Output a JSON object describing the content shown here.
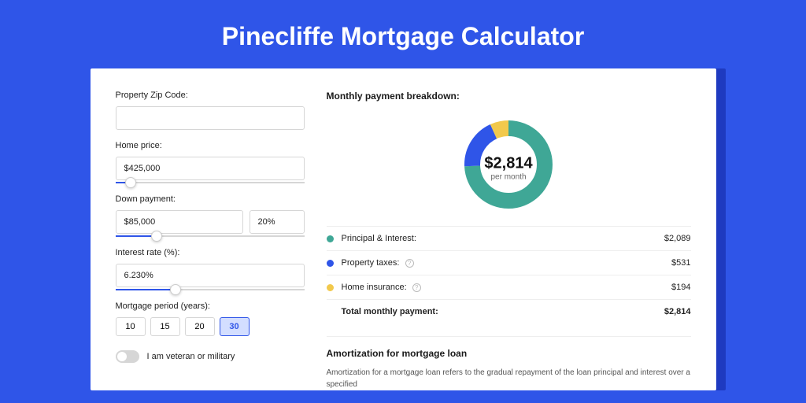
{
  "title": "Pinecliffe Mortgage Calculator",
  "form": {
    "zip": {
      "label": "Property Zip Code:",
      "value": ""
    },
    "home_price": {
      "label": "Home price:",
      "value": "$425,000",
      "slider_pct": 8
    },
    "down_payment": {
      "label": "Down payment:",
      "amount": "$85,000",
      "percent": "20%",
      "slider_pct": 22
    },
    "interest_rate": {
      "label": "Interest rate (%):",
      "value": "6.230%",
      "slider_pct": 32
    },
    "period": {
      "label": "Mortgage period (years):",
      "options": [
        "10",
        "15",
        "20",
        "30"
      ],
      "active": "30"
    },
    "veteran": {
      "label": "I am veteran or military"
    }
  },
  "breakdown": {
    "title": "Monthly payment breakdown:",
    "center_amount": "$2,814",
    "center_sub": "per month",
    "items": [
      {
        "label": "Principal & Interest:",
        "value": "$2,089",
        "info": false
      },
      {
        "label": "Property taxes:",
        "value": "$531",
        "info": true
      },
      {
        "label": "Home insurance:",
        "value": "$194",
        "info": true
      }
    ],
    "total": {
      "label": "Total monthly payment:",
      "value": "$2,814"
    }
  },
  "amort": {
    "title": "Amortization for mortgage loan",
    "text": "Amortization for a mortgage loan refers to the gradual repayment of the loan principal and interest over a specified"
  },
  "chart_data": {
    "type": "pie",
    "title": "Monthly payment breakdown",
    "series": [
      {
        "name": "Principal & Interest",
        "value": 2089,
        "color": "#3fa796"
      },
      {
        "name": "Property taxes",
        "value": 531,
        "color": "#2f55e8"
      },
      {
        "name": "Home insurance",
        "value": 194,
        "color": "#f2c94c"
      }
    ],
    "total": 2814
  },
  "colors": {
    "pi": "#3fa796",
    "tax": "#2f55e8",
    "ins": "#f2c94c"
  }
}
